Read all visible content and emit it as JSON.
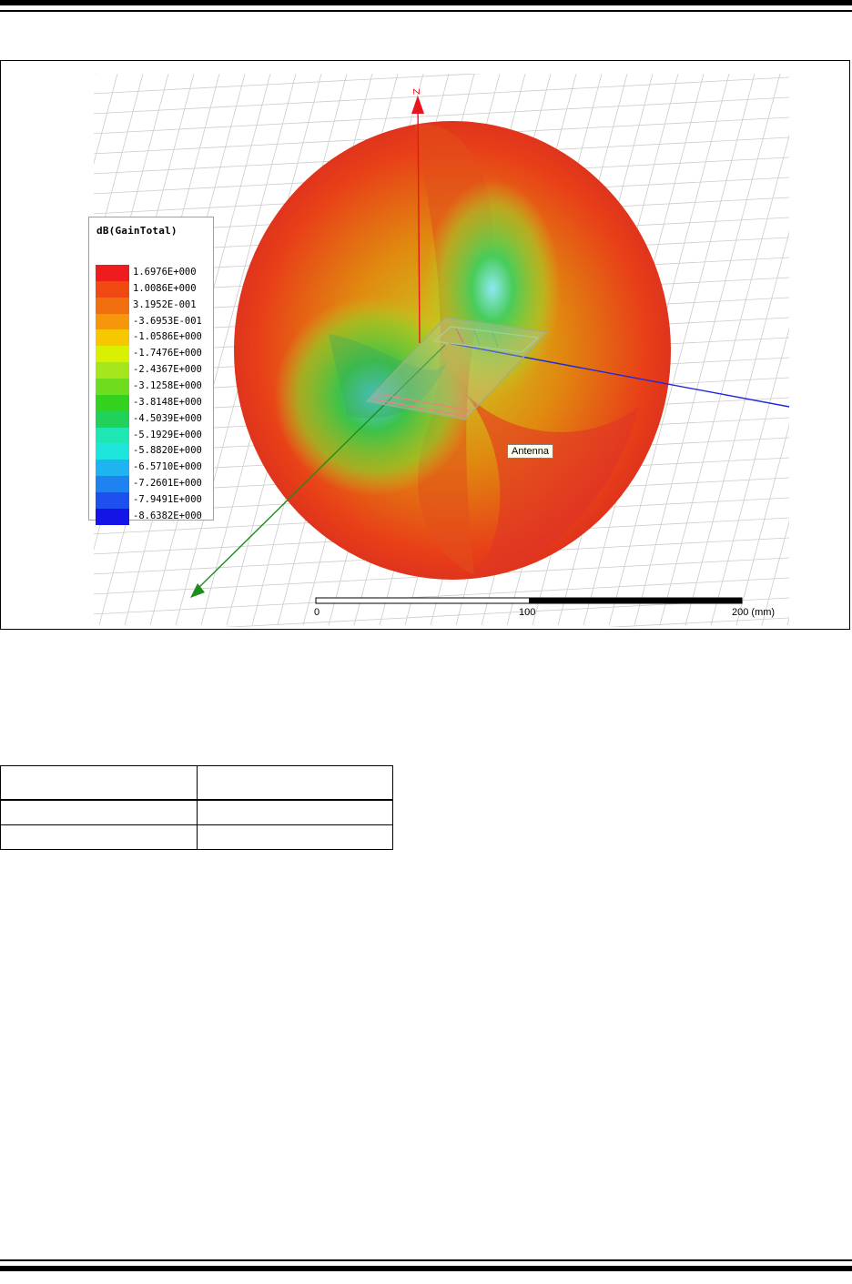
{
  "figure": {
    "legend": {
      "title": "dB(GainTotal)",
      "entries": [
        {
          "value": "1.6976E+000",
          "color": "#ee1c1c"
        },
        {
          "value": "1.0086E+000",
          "color": "#f04a12"
        },
        {
          "value": "3.1952E-001",
          "color": "#f26f10"
        },
        {
          "value": "-3.6953E-001",
          "color": "#f5960c"
        },
        {
          "value": "-1.0586E+000",
          "color": "#f7c800"
        },
        {
          "value": "-1.7476E+000",
          "color": "#d9f000"
        },
        {
          "value": "-2.4367E+000",
          "color": "#a6e61c"
        },
        {
          "value": "-3.1258E+000",
          "color": "#70dc1e"
        },
        {
          "value": "-3.8148E+000",
          "color": "#32d21e"
        },
        {
          "value": "-4.5039E+000",
          "color": "#20d25a"
        },
        {
          "value": "-5.1929E+000",
          "color": "#1ee6b4"
        },
        {
          "value": "-5.8820E+000",
          "color": "#1ee6dc"
        },
        {
          "value": "-6.5710E+000",
          "color": "#1eb4f0"
        },
        {
          "value": "-7.2601E+000",
          "color": "#1e82f0"
        },
        {
          "value": "-7.9491E+000",
          "color": "#1e50f0"
        },
        {
          "value": "-8.6382E+000",
          "color": "#1414e6"
        }
      ]
    },
    "axis_z_label": "Z",
    "antenna_label": "Antenna",
    "scale": {
      "start": "0",
      "mid": "100",
      "end": "200 (mm)"
    },
    "colors": {
      "z_axis": "#e8141e",
      "x_axis": "#1e28dc",
      "y_axis": "#1e8c1e",
      "grid": "#c8c8c8"
    }
  },
  "table": {
    "rows": [
      [
        "",
        ""
      ],
      [
        "",
        ""
      ],
      [
        "",
        ""
      ]
    ]
  }
}
